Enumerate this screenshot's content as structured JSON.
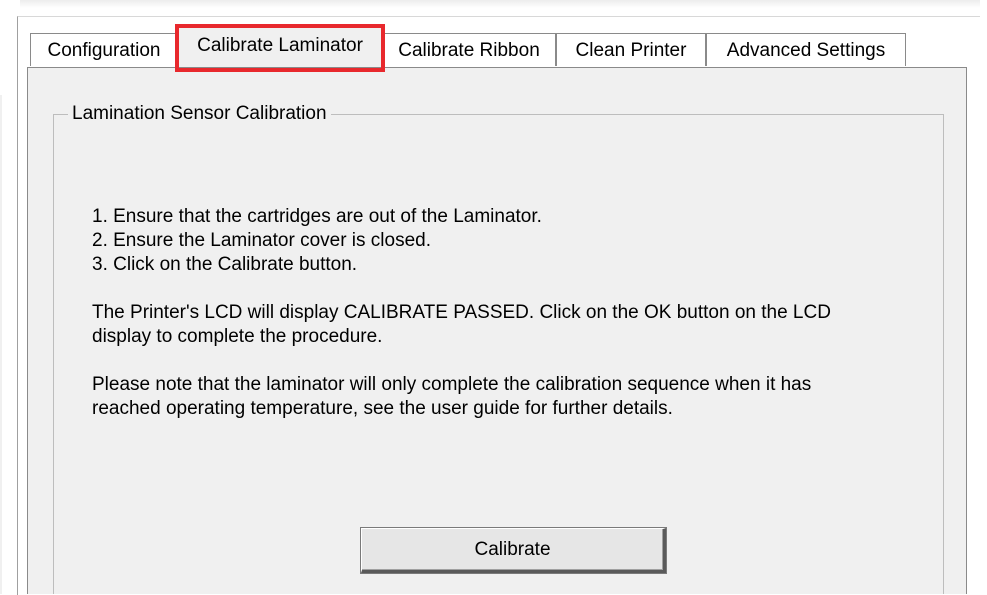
{
  "tabs": [
    {
      "label": "Configuration",
      "active": false
    },
    {
      "label": "Calibrate Laminator",
      "active": true
    },
    {
      "label": "Calibrate Ribbon",
      "active": false
    },
    {
      "label": "Clean Printer",
      "active": false
    },
    {
      "label": "Advanced Settings",
      "active": false
    }
  ],
  "highlight_color": "#e8282d",
  "groupbox": {
    "title": "Lamination Sensor Calibration"
  },
  "instructions": {
    "steps": [
      "1. Ensure that the cartridges are out of the Laminator.",
      "2. Ensure the Laminator cover is closed.",
      "3. Click on the Calibrate button."
    ],
    "lcd_note_line1": "The Printer's LCD will display CALIBRATE PASSED.  Click on the OK button on the LCD",
    "lcd_note_line2": "display to complete the procedure.",
    "temp_note_line1": "Please note that the laminator will only complete the calibration sequence when it has",
    "temp_note_line2": "reached operating temperature, see the user guide for further details."
  },
  "buttons": {
    "calibrate_label": "Calibrate"
  }
}
